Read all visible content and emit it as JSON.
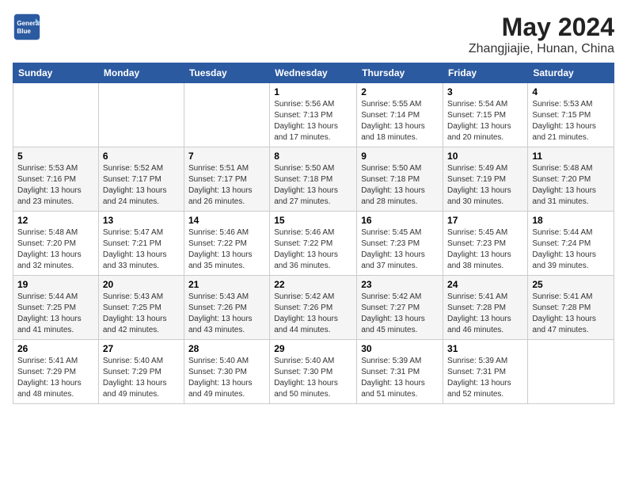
{
  "logo": {
    "line1": "General",
    "line2": "Blue"
  },
  "title": "May 2024",
  "subtitle": "Zhangjiajie, Hunan, China",
  "days_of_week": [
    "Sunday",
    "Monday",
    "Tuesday",
    "Wednesday",
    "Thursday",
    "Friday",
    "Saturday"
  ],
  "weeks": [
    [
      {
        "day": "",
        "sunrise": "",
        "sunset": "",
        "daylight": ""
      },
      {
        "day": "",
        "sunrise": "",
        "sunset": "",
        "daylight": ""
      },
      {
        "day": "",
        "sunrise": "",
        "sunset": "",
        "daylight": ""
      },
      {
        "day": "1",
        "sunrise": "5:56 AM",
        "sunset": "7:13 PM",
        "daylight": "13 hours and 17 minutes."
      },
      {
        "day": "2",
        "sunrise": "5:55 AM",
        "sunset": "7:14 PM",
        "daylight": "13 hours and 18 minutes."
      },
      {
        "day": "3",
        "sunrise": "5:54 AM",
        "sunset": "7:15 PM",
        "daylight": "13 hours and 20 minutes."
      },
      {
        "day": "4",
        "sunrise": "5:53 AM",
        "sunset": "7:15 PM",
        "daylight": "13 hours and 21 minutes."
      }
    ],
    [
      {
        "day": "5",
        "sunrise": "5:53 AM",
        "sunset": "7:16 PM",
        "daylight": "13 hours and 23 minutes."
      },
      {
        "day": "6",
        "sunrise": "5:52 AM",
        "sunset": "7:17 PM",
        "daylight": "13 hours and 24 minutes."
      },
      {
        "day": "7",
        "sunrise": "5:51 AM",
        "sunset": "7:17 PM",
        "daylight": "13 hours and 26 minutes."
      },
      {
        "day": "8",
        "sunrise": "5:50 AM",
        "sunset": "7:18 PM",
        "daylight": "13 hours and 27 minutes."
      },
      {
        "day": "9",
        "sunrise": "5:50 AM",
        "sunset": "7:18 PM",
        "daylight": "13 hours and 28 minutes."
      },
      {
        "day": "10",
        "sunrise": "5:49 AM",
        "sunset": "7:19 PM",
        "daylight": "13 hours and 30 minutes."
      },
      {
        "day": "11",
        "sunrise": "5:48 AM",
        "sunset": "7:20 PM",
        "daylight": "13 hours and 31 minutes."
      }
    ],
    [
      {
        "day": "12",
        "sunrise": "5:48 AM",
        "sunset": "7:20 PM",
        "daylight": "13 hours and 32 minutes."
      },
      {
        "day": "13",
        "sunrise": "5:47 AM",
        "sunset": "7:21 PM",
        "daylight": "13 hours and 33 minutes."
      },
      {
        "day": "14",
        "sunrise": "5:46 AM",
        "sunset": "7:22 PM",
        "daylight": "13 hours and 35 minutes."
      },
      {
        "day": "15",
        "sunrise": "5:46 AM",
        "sunset": "7:22 PM",
        "daylight": "13 hours and 36 minutes."
      },
      {
        "day": "16",
        "sunrise": "5:45 AM",
        "sunset": "7:23 PM",
        "daylight": "13 hours and 37 minutes."
      },
      {
        "day": "17",
        "sunrise": "5:45 AM",
        "sunset": "7:23 PM",
        "daylight": "13 hours and 38 minutes."
      },
      {
        "day": "18",
        "sunrise": "5:44 AM",
        "sunset": "7:24 PM",
        "daylight": "13 hours and 39 minutes."
      }
    ],
    [
      {
        "day": "19",
        "sunrise": "5:44 AM",
        "sunset": "7:25 PM",
        "daylight": "13 hours and 41 minutes."
      },
      {
        "day": "20",
        "sunrise": "5:43 AM",
        "sunset": "7:25 PM",
        "daylight": "13 hours and 42 minutes."
      },
      {
        "day": "21",
        "sunrise": "5:43 AM",
        "sunset": "7:26 PM",
        "daylight": "13 hours and 43 minutes."
      },
      {
        "day": "22",
        "sunrise": "5:42 AM",
        "sunset": "7:26 PM",
        "daylight": "13 hours and 44 minutes."
      },
      {
        "day": "23",
        "sunrise": "5:42 AM",
        "sunset": "7:27 PM",
        "daylight": "13 hours and 45 minutes."
      },
      {
        "day": "24",
        "sunrise": "5:41 AM",
        "sunset": "7:28 PM",
        "daylight": "13 hours and 46 minutes."
      },
      {
        "day": "25",
        "sunrise": "5:41 AM",
        "sunset": "7:28 PM",
        "daylight": "13 hours and 47 minutes."
      }
    ],
    [
      {
        "day": "26",
        "sunrise": "5:41 AM",
        "sunset": "7:29 PM",
        "daylight": "13 hours and 48 minutes."
      },
      {
        "day": "27",
        "sunrise": "5:40 AM",
        "sunset": "7:29 PM",
        "daylight": "13 hours and 49 minutes."
      },
      {
        "day": "28",
        "sunrise": "5:40 AM",
        "sunset": "7:30 PM",
        "daylight": "13 hours and 49 minutes."
      },
      {
        "day": "29",
        "sunrise": "5:40 AM",
        "sunset": "7:30 PM",
        "daylight": "13 hours and 50 minutes."
      },
      {
        "day": "30",
        "sunrise": "5:39 AM",
        "sunset": "7:31 PM",
        "daylight": "13 hours and 51 minutes."
      },
      {
        "day": "31",
        "sunrise": "5:39 AM",
        "sunset": "7:31 PM",
        "daylight": "13 hours and 52 minutes."
      },
      {
        "day": "",
        "sunrise": "",
        "sunset": "",
        "daylight": ""
      }
    ]
  ],
  "colors": {
    "header_bg": "#2c5aa0",
    "header_text": "#ffffff",
    "row_even": "#f5f5f5",
    "row_odd": "#ffffff"
  }
}
